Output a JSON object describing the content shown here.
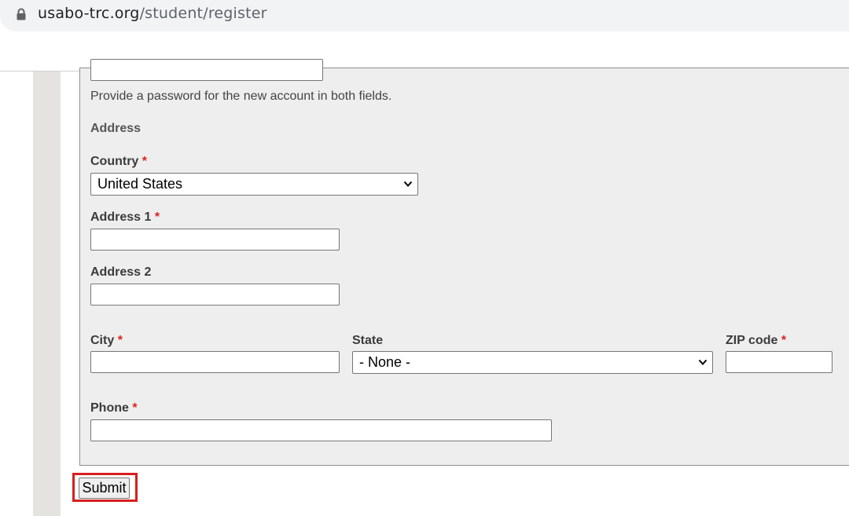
{
  "browser": {
    "url_domain": "usabo-trc.org",
    "url_path": "/student/register"
  },
  "form": {
    "password_help": "Provide a password for the new account in both fields.",
    "address_section_title": "Address",
    "required_marker": "*",
    "country": {
      "label": "Country",
      "value": "United States"
    },
    "address1": {
      "label": "Address 1",
      "value": ""
    },
    "address2": {
      "label": "Address 2",
      "value": ""
    },
    "city": {
      "label": "City",
      "value": ""
    },
    "state": {
      "label": "State",
      "value": "- None -"
    },
    "zip": {
      "label": "ZIP code",
      "value": ""
    },
    "phone": {
      "label": "Phone",
      "value": ""
    },
    "submit_label": "Submit"
  },
  "colors": {
    "required": "#e02020",
    "highlight": "#d61f1f",
    "panel_bg": "#eeeeee"
  }
}
